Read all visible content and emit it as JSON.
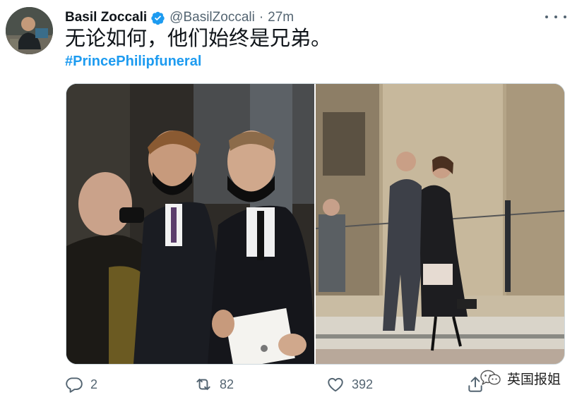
{
  "tweet": {
    "author_name": "Basil Zoccali",
    "handle": "@BasilZoccali",
    "separator": "·",
    "time": "27m",
    "text": "无论如何，他们始终是兄弟。",
    "hashtag": "#PrincePhilipfuneral"
  },
  "actions": {
    "reply_count": "2",
    "retweet_count": "82",
    "like_count": "392"
  },
  "watermark": {
    "text": "英国报姐"
  },
  "colors": {
    "accent": "#1d9bf0",
    "secondary_text": "#536471"
  },
  "icons": [
    "verified-badge-icon",
    "more-options-icon",
    "reply-icon",
    "retweet-icon",
    "like-icon",
    "share-icon",
    "wechat-icon"
  ]
}
